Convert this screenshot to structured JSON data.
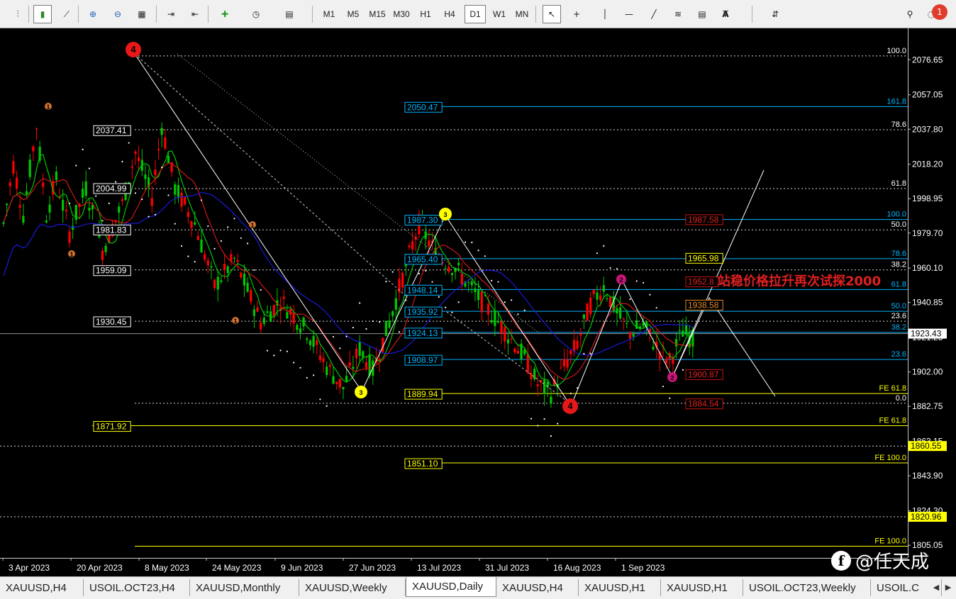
{
  "toolbar": {
    "timeframes": [
      "M1",
      "M5",
      "M15",
      "M30",
      "H1",
      "H4",
      "D1",
      "W1",
      "MN"
    ],
    "active_timeframe": "D1",
    "text_tool": "A",
    "notification_count": "1",
    "icons": [
      "bar-chart-icon",
      "candle-chart-icon",
      "line-chart-icon",
      "zoom-in-icon",
      "zoom-out-icon",
      "tile-windows-icon",
      "autoscroll-icon",
      "chart-shift-icon",
      "new-order-icon",
      "history-clock-icon",
      "templates-icon",
      "cursor-icon",
      "crosshair-icon",
      "vertical-line-icon",
      "horizontal-line-icon",
      "trendline-icon",
      "equidistant-channel-icon",
      "fibonacci-icon",
      "text-label-icon",
      "arrows-icon",
      "search-icon",
      "chat-icon"
    ]
  },
  "price_axis": {
    "ticks": [
      "2076.65",
      "2057.05",
      "2037.80",
      "2018.20",
      "1998.95",
      "1979.70",
      "1960.10",
      "1940.85",
      "1921.25",
      "1902.00",
      "1882.75",
      "1863.15",
      "1843.90",
      "1824.30",
      "1805.05"
    ],
    "current_price": "1923.43",
    "marked": [
      {
        "price": "1860.55",
        "color": "#ffff00"
      },
      {
        "price": "1820.96",
        "color": "#ffff00"
      }
    ]
  },
  "time_axis": {
    "labels": [
      "3 Apr 2023",
      "20 Apr 2023",
      "8 May 2023",
      "24 May 2023",
      "9 Jun 2023",
      "27 Jun 2023",
      "13 Jul 2023",
      "31 Jul 2023",
      "16 Aug 2023",
      "1 Sep 2023"
    ]
  },
  "price_labels": {
    "white": [
      "2037.41",
      "2004.99",
      "1981.83",
      "1959.09",
      "1930.45"
    ],
    "yellow_left": [
      "1871.92"
    ],
    "cyan": [
      "2050.47",
      "1987.30",
      "1965.40",
      "1948.14",
      "1935.92",
      "1924.13",
      "1908.97"
    ],
    "yellow_mid": [
      "1889.94",
      "1851.10",
      "1965.98"
    ],
    "red": [
      "1987.58",
      "1952.8",
      "1900.87",
      "1884.54"
    ],
    "orange": [
      "1938.58"
    ]
  },
  "fib_levels": {
    "white": [
      "100.0",
      "78.6",
      "61.8",
      "50.0",
      "38.2",
      "23.6",
      "0.0"
    ],
    "cyan": [
      "161.8",
      "100.0",
      "78.6",
      "61.8",
      "50.0",
      "38.2",
      "23.6"
    ],
    "yellow": [
      "FE 61.8",
      "FE 61.8",
      "FE 100.0",
      "FE 100.0"
    ]
  },
  "wave_labels": [
    "4",
    "3",
    "4",
    "1",
    "1",
    "1",
    "1",
    "3",
    "2",
    "2"
  ],
  "annotation": "站稳价格拉升再次试探2000",
  "tabs": [
    "XAUUSD,H4",
    "USOIL.OCT23,H4",
    "XAUUSD,Monthly",
    "XAUUSD,Weekly",
    "XAUUSD,Daily",
    "XAUUSD,H4",
    "XAUUSD,H1",
    "XAUUSD,H1",
    "USOIL.OCT23,Weekly",
    "USOIL.C"
  ],
  "active_tab": "XAUUSD,Daily",
  "watermark": "@任天成",
  "watermark_logo": "f",
  "colors": {
    "bull": "#00c800",
    "bear": "#ff0000",
    "fib_white": "#ffffff",
    "fib_cyan": "#00b4ff",
    "fib_yellow": "#ffff00",
    "ma_green": "#00c800",
    "ma_red": "#d01818",
    "ma_blue": "#1a1adc"
  }
}
